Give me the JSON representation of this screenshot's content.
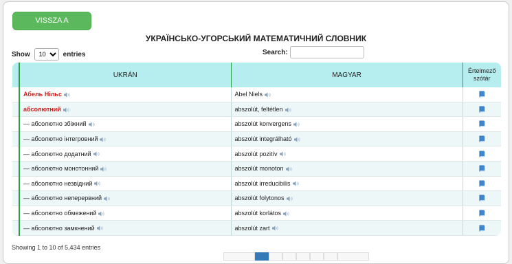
{
  "header": {
    "back_button": "VISSZA A FŐOLDALRA",
    "title": "УКРАЇНСЬКО-УГОРСЬКИЙ МАТЕМАТИЧНИЙ СЛОВНИК"
  },
  "controls": {
    "show_label": "Show",
    "page_size": "10",
    "entries_label": "entries",
    "search_label": "Search:",
    "search_value": ""
  },
  "table": {
    "columns": [
      "",
      "UKRÁN",
      "MAGYAR",
      "Értelmező szótár"
    ],
    "rows": [
      {
        "uk": "Абель Нільс",
        "hu": "Abel Niels",
        "highlight": true
      },
      {
        "uk": "абсолютний",
        "hu": "abszolút, feltétlen",
        "highlight": true
      },
      {
        "uk": "— абсолютно збіжний",
        "hu": "abszolút konvergens",
        "highlight": false
      },
      {
        "uk": "— абсолютно інтегровний",
        "hu": "abszolút integrálható",
        "highlight": false
      },
      {
        "uk": "— абсолютно додатний",
        "hu": "abszolút pozitív",
        "highlight": false
      },
      {
        "uk": "— абсолютно монотонний",
        "hu": "abszolút monoton",
        "highlight": false
      },
      {
        "uk": "— абсолютно незвідний",
        "hu": "abszolút irreducibilis",
        "highlight": false
      },
      {
        "uk": "— абсолютно неперервний",
        "hu": "abszolút folytonos",
        "highlight": false
      },
      {
        "uk": "— абсолютно обмежений",
        "hu": "abszolút korlátos",
        "highlight": false
      },
      {
        "uk": "— абсолютно замкнений",
        "hu": "abszolút zart",
        "highlight": false
      }
    ]
  },
  "footer": {
    "info": "Showing 1 to 10 of 5,434 entries"
  },
  "icons": {
    "speaker": "speaker-icon",
    "dictionary": "book-icon"
  },
  "colors": {
    "button_green": "#5cb85c",
    "header_cyan": "#b6eef0",
    "divider_green": "#2a9d47",
    "highlight_red": "#d11b1b",
    "book_blue": "#2e6fb0"
  }
}
